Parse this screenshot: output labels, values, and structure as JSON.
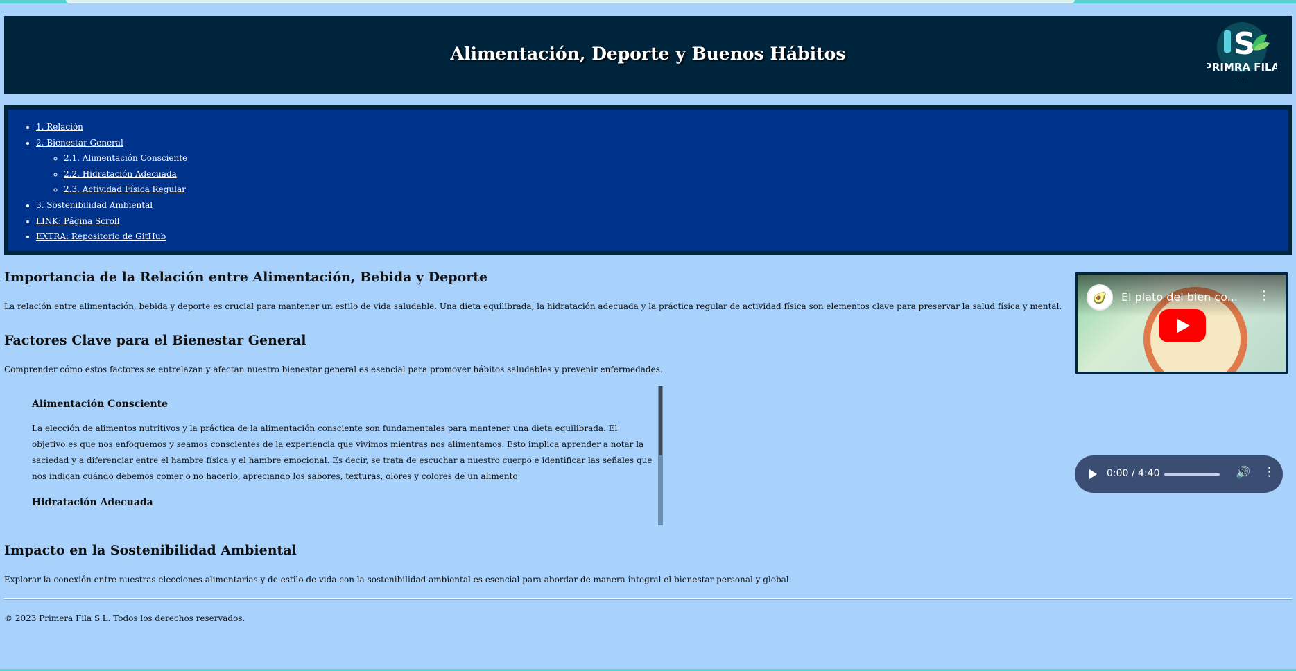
{
  "header": {
    "title": "Alimentación, Deporte y Buenos Hábitos",
    "logo_text": "PRIMRA FILA"
  },
  "nav": {
    "items": [
      {
        "label": "1. Relación"
      },
      {
        "label": "2. Bienestar General",
        "children": [
          {
            "label": "2.1. Alimentación Consciente"
          },
          {
            "label": "2.2. Hidratación Adecuada"
          },
          {
            "label": "2.3. Actividad Física Regular"
          }
        ]
      },
      {
        "label": "3. Sostenibilidad Ambiental"
      },
      {
        "label": "LINK: Página Scroll"
      },
      {
        "label": "EXTRA: Repositorio de GitHub"
      }
    ]
  },
  "sections": {
    "relation": {
      "heading": "Importancia de la Relación entre Alimentación, Bebida y Deporte",
      "text": "La relación entre alimentación, bebida y deporte es crucial para mantener un estilo de vida saludable. Una dieta equilibrada, la hidratación adecuada y la práctica regular de actividad física son elementos clave para preservar la salud física y mental."
    },
    "wellbeing": {
      "heading": "Factores Clave para el Bienestar General",
      "text": "Comprender cómo estos factores se entrelazan y afectan nuestro bienestar general es esencial para promover hábitos saludables y prevenir enfermedades.",
      "sub": [
        {
          "heading": "Alimentación Consciente",
          "text": "La elección de alimentos nutritivos y la práctica de la alimentación consciente son fundamentales para mantener una dieta equilibrada. El objetivo es que nos enfoquemos y seamos conscientes de la experiencia que vivimos mientras nos alimentamos. Esto implica aprender a notar la saciedad y a diferenciar entre el hambre física y el hambre emocional. Es decir, se trata de escuchar a nuestro cuerpo e identificar las señales que nos indican cuándo debemos comer o no hacerlo, apreciando los sabores, texturas, olores y colores de un alimento"
        },
        {
          "heading": "Hidratación Adecuada"
        }
      ]
    },
    "sustainability": {
      "heading": "Impacto en la Sostenibilidad Ambiental",
      "text": "Explorar la conexión entre nuestras elecciones alimentarias y de estilo de vida con la sostenibilidad ambiental es esencial para abordar de manera integral el bienestar personal y global."
    }
  },
  "video": {
    "title": "El plato del bien co...",
    "channel_icon": "avocado-icon"
  },
  "audio": {
    "time": "0:00 / 4:40"
  },
  "footer": {
    "text": "© 2023 Primera Fila S.L. Todos los derechos reservados."
  },
  "colors": {
    "background": "#a8d1fb",
    "header_bg": "#00243b",
    "nav_bg": "#00338b",
    "audio_bg": "#3b4d72"
  }
}
